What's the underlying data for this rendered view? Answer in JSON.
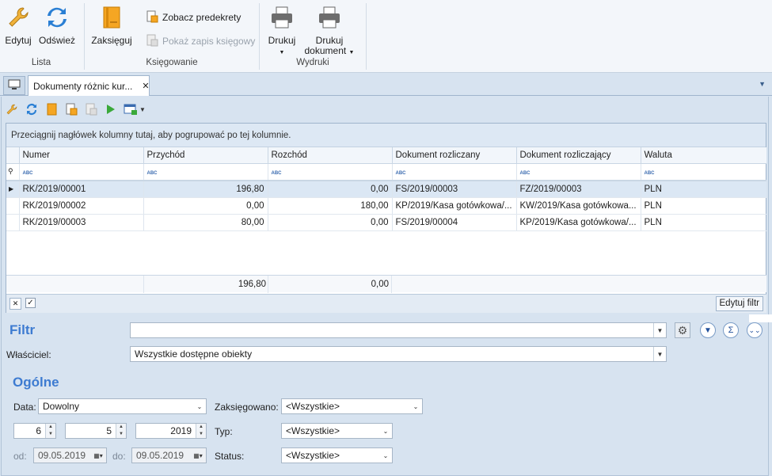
{
  "ribbon": {
    "lista": {
      "edit": "Edytuj",
      "refresh": "Odśwież",
      "label": "Lista"
    },
    "ksiegowanie": {
      "post": "Zaksięguj",
      "show_predecrees": "Zobacz predekrety",
      "show_entry": "Pokaż zapis księgowy",
      "label": "Księgowanie"
    },
    "wydruki": {
      "print": "Drukuj",
      "print_doc_1": "Drukuj",
      "print_doc_2": "dokument",
      "label": "Wydruki"
    }
  },
  "tab": {
    "title": "Dokumenty różnic kur...",
    "close": "✕"
  },
  "grid": {
    "group_hint": "Przeciągnij nagłówek kolumny tutaj, aby pogrupować po tej kolumnie.",
    "columns": [
      "Numer",
      "Przychód",
      "Rozchód",
      "Dokument rozliczany",
      "Dokument rozliczający",
      "Waluta"
    ],
    "rows": [
      {
        "numer": "RK/2019/00001",
        "przychod": "196,80",
        "rozchod": "0,00",
        "rozliczany": "FS/2019/00003",
        "rozliczajacy": "FZ/2019/00003",
        "waluta": "PLN"
      },
      {
        "numer": "RK/2019/00002",
        "przychod": "0,00",
        "rozchod": "180,00",
        "rozliczany": "KP/2019/Kasa gotówkowa/...",
        "rozliczajacy": "KW/2019/Kasa gotówkowa...",
        "waluta": "PLN"
      },
      {
        "numer": "RK/2019/00003",
        "przychod": "80,00",
        "rozchod": "0,00",
        "rozliczany": "FS/2019/00004",
        "rozliczajacy": "KP/2019/Kasa gotówkowa/...",
        "waluta": "PLN"
      }
    ],
    "totals": {
      "przychod": "196,80",
      "rozchod": "0,00"
    },
    "edit_filter": "Edytuj filtr"
  },
  "filter": {
    "title": "Filtr",
    "value": "",
    "owner_label": "Właściciel:",
    "owner_value": "Wszystkie dostępne obiekty"
  },
  "general": {
    "title": "Ogólne",
    "date_label": "Data:",
    "date_value": "Dowolny",
    "month": "6",
    "day": "5",
    "year": "2019",
    "from_label": "od:",
    "from_value": "09.05.2019",
    "to_label": "do:",
    "to_value": "09.05.2019",
    "posted_label": "Zaksięgowano:",
    "posted_value": "<Wszystkie>",
    "type_label": "Typ:",
    "type_value": "<Wszystkie>",
    "status_label": "Status:",
    "status_value": "<Wszystkie>"
  },
  "colors": {
    "accent": "#3d7bd1",
    "panel": "#d7e3f0",
    "selected_row": "#dbe7f4"
  }
}
